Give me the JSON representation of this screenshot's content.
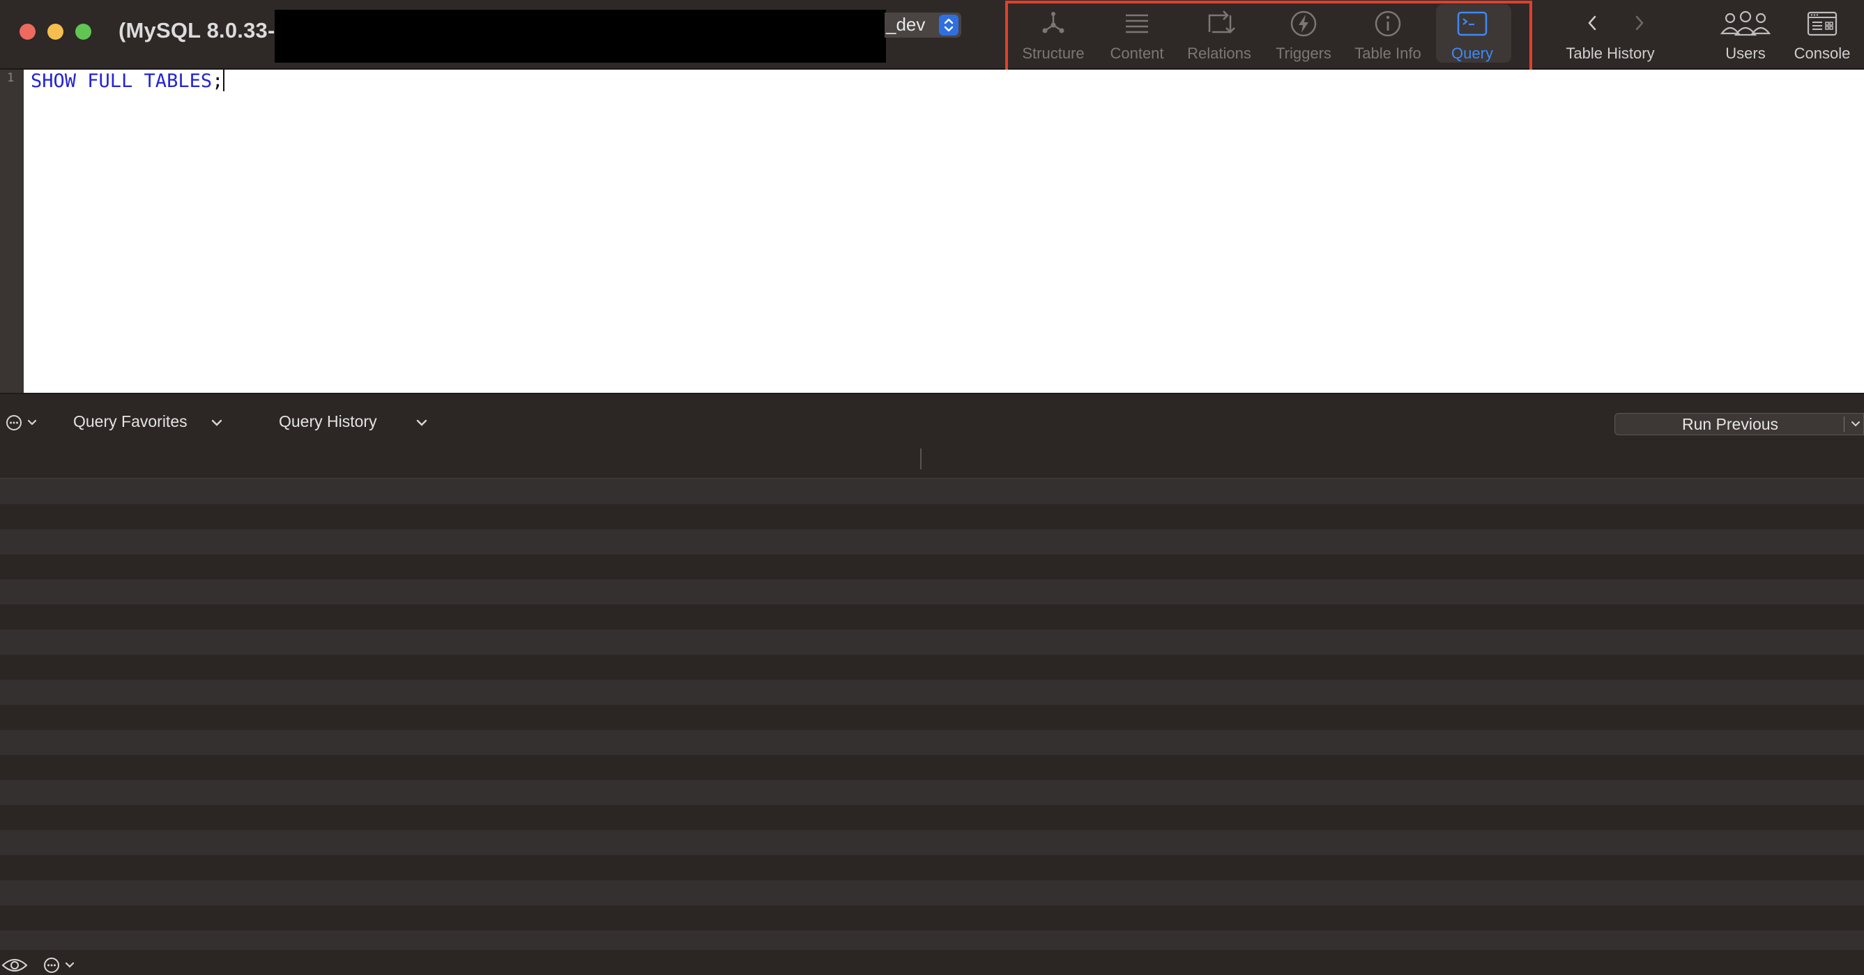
{
  "window": {
    "title": "(MySQL 8.0.33-",
    "database_suffix": "_dev"
  },
  "toolbar": {
    "items": [
      {
        "label": "Structure",
        "icon": "structure-icon"
      },
      {
        "label": "Content",
        "icon": "content-icon"
      },
      {
        "label": "Relations",
        "icon": "relations-icon"
      },
      {
        "label": "Triggers",
        "icon": "triggers-icon"
      },
      {
        "label": "Table Info",
        "icon": "info-icon"
      },
      {
        "label": "Query",
        "icon": "query-terminal-icon",
        "active": true
      }
    ],
    "table_history_label": "Table History",
    "users_label": "Users",
    "console_label": "Console"
  },
  "editor": {
    "line_number": "1",
    "code": "SHOW FULL TABLES",
    "terminator": ";"
  },
  "query_bar": {
    "favorites_label": "Query Favorites",
    "history_label": "Query History",
    "run_previous_label": "Run Previous"
  },
  "colors": {
    "accent": "#3d8af7",
    "highlight_box": "#e0402b",
    "sql_keyword": "#2424d6",
    "row_dark": "#2b2624",
    "row_light": "#353030"
  }
}
